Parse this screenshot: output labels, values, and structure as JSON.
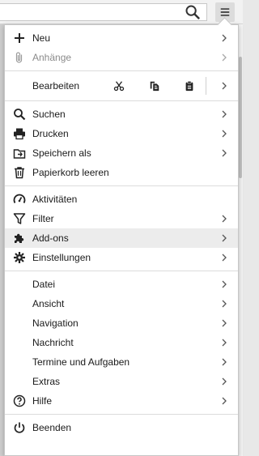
{
  "menu": {
    "groups": [
      {
        "items": [
          {
            "label": "Neu",
            "icon": "plus-icon",
            "submenu": true,
            "disabled": false
          },
          {
            "label": "Anhänge",
            "icon": "paperclip-icon",
            "submenu": true,
            "disabled": true
          }
        ]
      },
      {
        "edit": {
          "label": "Bearbeiten",
          "cut_icon": "scissors-icon",
          "copy_icon": "copy-icon",
          "paste_icon": "clipboard-icon",
          "submenu": true
        }
      },
      {
        "items": [
          {
            "label": "Suchen",
            "icon": "search-icon",
            "submenu": true
          },
          {
            "label": "Drucken",
            "icon": "printer-icon",
            "submenu": true
          },
          {
            "label": "Speichern als",
            "icon": "save-as-icon",
            "submenu": true
          },
          {
            "label": "Papierkorb leeren",
            "icon": "trash-icon",
            "submenu": false
          }
        ]
      },
      {
        "items": [
          {
            "label": "Aktivitäten",
            "icon": "gauge-icon",
            "submenu": false
          },
          {
            "label": "Filter",
            "icon": "filter-icon",
            "submenu": true
          },
          {
            "label": "Add-ons",
            "icon": "puzzle-icon",
            "submenu": true,
            "highlighted": true
          },
          {
            "label": "Einstellungen",
            "icon": "gear-icon",
            "submenu": true
          }
        ]
      },
      {
        "items": [
          {
            "label": "Datei",
            "submenu": true
          },
          {
            "label": "Ansicht",
            "submenu": true
          },
          {
            "label": "Navigation",
            "submenu": true
          },
          {
            "label": "Nachricht",
            "submenu": true
          },
          {
            "label": "Termine und Aufgaben",
            "submenu": true
          },
          {
            "label": "Extras",
            "submenu": true
          },
          {
            "label": "Hilfe",
            "icon": "help-icon",
            "submenu": true
          }
        ]
      },
      {
        "items": [
          {
            "label": "Beenden",
            "icon": "power-icon",
            "submenu": false
          }
        ]
      }
    ]
  },
  "toolbar": {
    "search_icon": "search-icon",
    "menu_icon": "hamburger-menu-icon"
  },
  "colors": {
    "hover": "#ececec",
    "disabled_text": "#8a8a8a",
    "separator": "#dcdcdc"
  }
}
